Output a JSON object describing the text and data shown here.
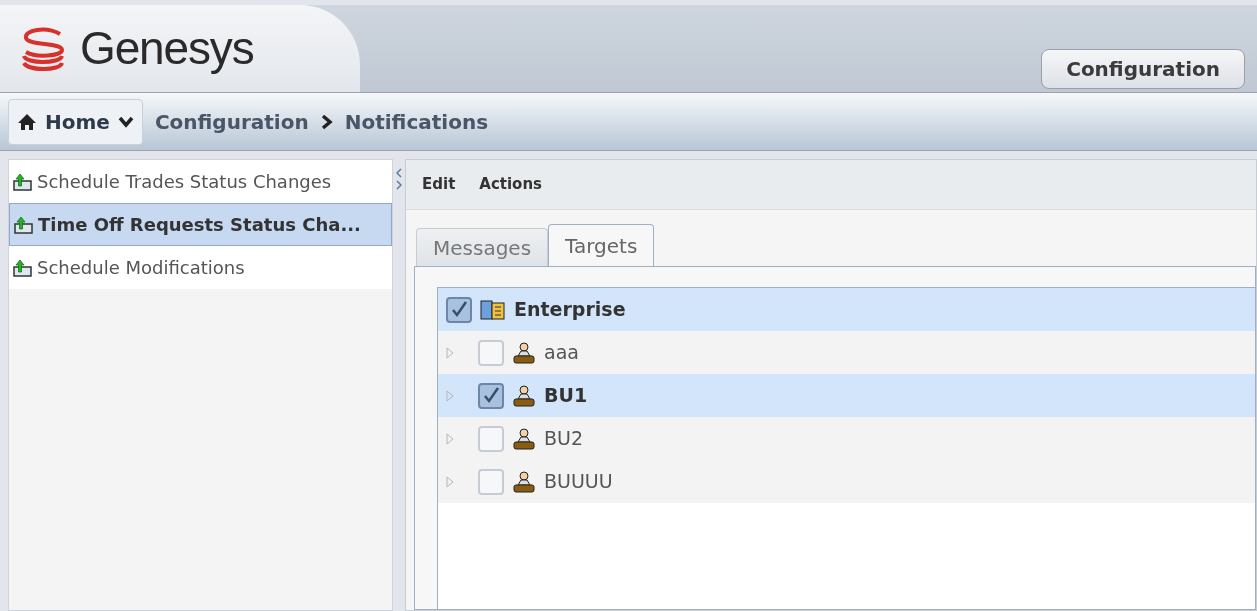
{
  "header": {
    "logo_text": "Genesys",
    "module_button": "Configuration"
  },
  "breadcrumb": [
    {
      "label": "Home",
      "kind": "home"
    },
    {
      "label": "Configuration",
      "kind": "link"
    },
    {
      "label": "Notifications",
      "kind": "current"
    }
  ],
  "sidebar": {
    "items": [
      {
        "label": "Schedule Trades Status Changes",
        "selected": false
      },
      {
        "label": "Time Off Requests Status Cha...",
        "selected": true
      },
      {
        "label": "Schedule Modifications",
        "selected": false
      }
    ]
  },
  "menu": [
    "Edit",
    "Actions"
  ],
  "tabs": [
    {
      "label": "Messages",
      "selected": false
    },
    {
      "label": "Targets",
      "selected": true
    }
  ],
  "tree": [
    {
      "label": "Enterprise",
      "kind": "enterprise",
      "checked": true,
      "selected": true,
      "children": [
        {
          "label": "aaa",
          "kind": "unit",
          "checked": false,
          "selected": false
        },
        {
          "label": "BU1",
          "kind": "unit",
          "checked": true,
          "selected": true
        },
        {
          "label": "BU2",
          "kind": "unit",
          "checked": false,
          "selected": false
        },
        {
          "label": "BUUUU",
          "kind": "unit",
          "checked": false,
          "selected": false
        }
      ]
    }
  ]
}
